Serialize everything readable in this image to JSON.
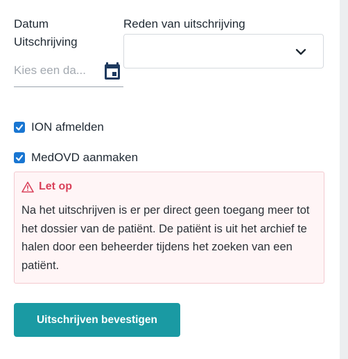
{
  "form": {
    "date_label": "Datum Uitschrijving",
    "date_placeholder": "Kies een da...",
    "reason_label": "Reden van uitschrijving",
    "reason_value": ""
  },
  "checkboxes": [
    {
      "label": "ION afmelden",
      "checked": true
    },
    {
      "label": "MedOVD aanmaken",
      "checked": true
    }
  ],
  "alert": {
    "title": "Let op",
    "message": "Na het uitschrijven is er per direct geen toegang meer tot het dossier van de patiënt. De patiënt is uit het archief te halen door een beheerder tijdens het zoeken van een patiënt.",
    "icon": "warning-triangle-icon",
    "color": "#d9415a"
  },
  "actions": {
    "confirm_label": "Uitschrijven bevestigen",
    "confirm_color": "#1a9aa3"
  },
  "colors": {
    "checkbox": "#1976d2",
    "calendar_icon": "#1e3a5f"
  }
}
